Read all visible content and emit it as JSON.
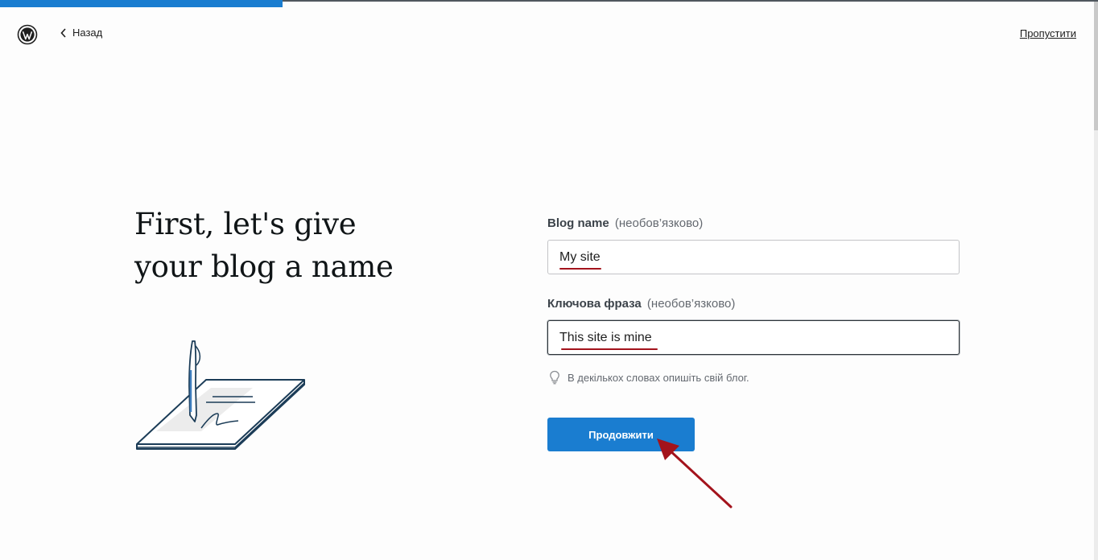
{
  "progress": {
    "fraction": 0.257
  },
  "header": {
    "back_label": "Назад",
    "skip_label": "Пропустити"
  },
  "main": {
    "heading_line1": "First, let's give",
    "heading_line2": "your blog a name"
  },
  "form": {
    "blog_name": {
      "label": "Blog name",
      "optional": "(необов’язково)",
      "value": "My site"
    },
    "tagline": {
      "label": "Ключова фраза",
      "optional": "(необов’язково)",
      "value": "This site is mine"
    },
    "hint": "В декількох словах опишіть свій блог.",
    "continue_label": "Продовжити"
  },
  "colors": {
    "accent": "#1a7dd0",
    "annotation": "#a3131c"
  },
  "icons": [
    "wordpress-logo-icon",
    "chevron-left-icon",
    "lightbulb-icon",
    "annotation-arrow-icon"
  ]
}
